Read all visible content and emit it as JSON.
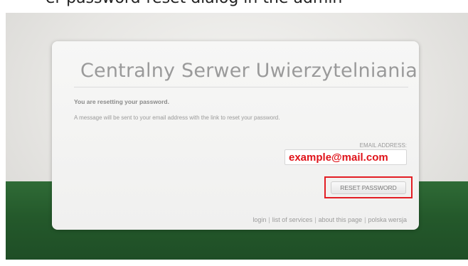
{
  "caption": {
    "text": "er-password-reset dialog in the admin"
  },
  "card": {
    "title": "Centralny Serwer Uwierzytelniania",
    "lead": "You are resetting your password.",
    "info": "A message will be sent to your email address with the link to reset your password.",
    "email_label": "EMAIL ADDRESS:",
    "email_value": "example@mail.com",
    "reset_button": "RESET PASSWORD"
  },
  "footer": {
    "links": [
      {
        "label": "login"
      },
      {
        "label": "list of services"
      },
      {
        "label": "about this page"
      },
      {
        "label": "polska wersja"
      }
    ],
    "separator": "|"
  },
  "colors": {
    "accent_red": "#e31e24",
    "green_band": "#2f6b36",
    "title_gray": "#9a9a9a"
  }
}
